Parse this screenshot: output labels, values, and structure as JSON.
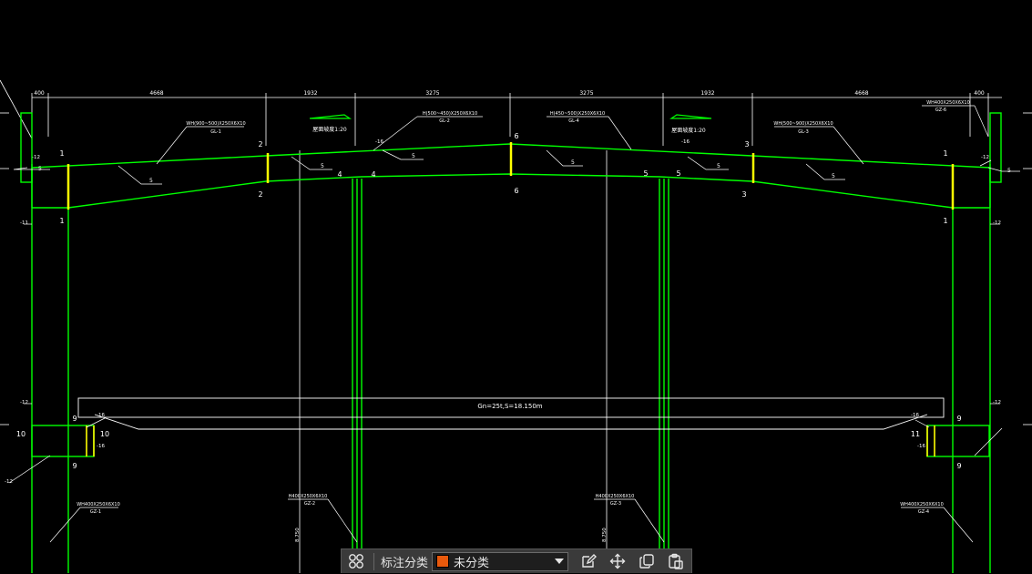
{
  "colors": {
    "background": "#000000",
    "frame": "#00ff00",
    "member": "#ffff00",
    "dimension": "#ffffff",
    "category_swatch": "#e8590c"
  },
  "drawing": {
    "dimensions": [
      "400",
      "4668",
      "1932",
      "3275",
      "3275",
      "1932",
      "4668",
      "400"
    ],
    "beams": [
      {
        "spec": "WH(900~500)X250X6X10",
        "tag": "GL-1"
      },
      {
        "spec": "H(500~450)X250X6X10",
        "tag": "GL-2"
      },
      {
        "spec": "H(450~500)X250X6X10",
        "tag": "GL-4"
      },
      {
        "spec": "WH(500~900)X250X6X10",
        "tag": "GL-3"
      }
    ],
    "corner_right_spec": "WH400X250X6X10",
    "corner_right_tag": "GZ-6",
    "slope_left": "屋面坡度1:20",
    "slope_right": "屋面坡度1:20",
    "crane_label": "Gn=25t,S=18.150m",
    "columns": [
      {
        "spec": "WH400X250X6X10",
        "tag": "GZ-1"
      },
      {
        "spec": "H400X250X6X10",
        "tag": "GZ-2"
      },
      {
        "spec": "H400X250X6X10",
        "tag": "GZ-3"
      },
      {
        "spec": "WH400X250X6X10",
        "tag": "GZ-4"
      }
    ],
    "section_marks": [
      "1",
      "2",
      "4",
      "6",
      "5",
      "3",
      "1",
      "9",
      "10",
      "11"
    ],
    "weld_marks": [
      "-12",
      "-16",
      "-12",
      "-11",
      "-12",
      "-16"
    ],
    "column_heights": [
      "8.750",
      "8.750"
    ],
    "stiffener_mark": "5"
  },
  "toolbar": {
    "category_label": "标注分类",
    "category_value": "未分类"
  }
}
